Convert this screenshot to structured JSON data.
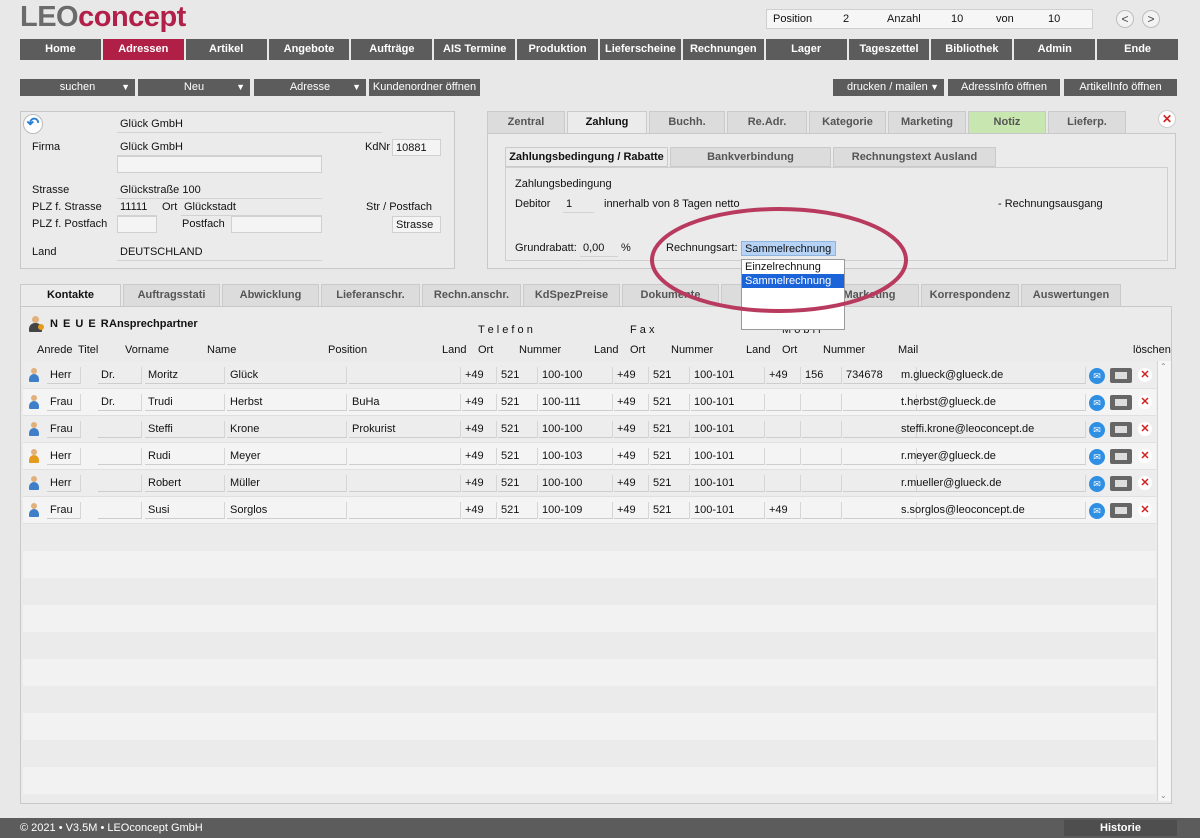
{
  "logo": {
    "part1": "LEO",
    "part2": "concept"
  },
  "pager": {
    "position_label": "Position",
    "position_value": "2",
    "count_label": "Anzahl",
    "count_value": "10",
    "of_label": "von",
    "of_value": "10",
    "prev": "<",
    "next": ">"
  },
  "nav": [
    "Home",
    "Adressen",
    "Artikel",
    "Angebote",
    "Aufträge",
    "AIS Termine",
    "Produktion",
    "Lieferscheine",
    "Rechnungen",
    "Lager",
    "Tageszettel",
    "Bibliothek",
    "Admin",
    "Ende"
  ],
  "toolbar": {
    "search": "suchen",
    "new": "Neu",
    "address": "Adresse",
    "customer_folder": "Kundenordner öffnen",
    "print": "drucken / mailen",
    "address_info": "AdressInfo öffnen",
    "article_info": "ArtikelInfo öffnen"
  },
  "address": {
    "name_line": "Glück GmbH",
    "firma_label": "Firma",
    "firma_value": "Glück GmbH",
    "kdnr_label": "KdNr",
    "kdnr_value": "10881",
    "strasse_label": "Strasse",
    "strasse_value": "Glückstraße 100",
    "plz_strasse_label": "PLZ f. Strasse",
    "plz_value": "11111",
    "ort_label": "Ort",
    "ort_value": "Glückstadt",
    "str_postfach_label": "Str / Postfach",
    "str_postfach_value": "Strasse",
    "plz_postfach_label": "PLZ f. Postfach",
    "postfach_label": "Postfach",
    "land_label": "Land",
    "land_value": "DEUTSCHLAND"
  },
  "right_tabs": [
    "Zentral",
    "Zahlung",
    "Buchh.",
    "Re.Adr.",
    "Kategorie",
    "Marketing",
    "Notiz",
    "Lieferp."
  ],
  "payment": {
    "subtabs": [
      "Zahlungsbedingung / Rabatte",
      "Bankverbindung",
      "Rechnungstext Ausland"
    ],
    "section_label": "Zahlungsbedingung",
    "debitor_label": "Debitor",
    "debitor_value": "1",
    "debitor_text": "innerhalb von 8 Tagen netto",
    "rechnungsausgang": "- Rechnungsausgang",
    "grundrabatt_label": "Grundrabatt:",
    "grundrabatt_value": "0,00",
    "percent": "%",
    "rechnungsart_label": "Rechnungsart:",
    "rechnungsart_value": "Sammelrechnung",
    "options": [
      "Einzelrechnung",
      "Sammelrechnung"
    ]
  },
  "bottom_tabs": [
    "Kontakte",
    "Auftragsstati",
    "Abwicklung",
    "Lieferanschr.",
    "Rechn.anschr.",
    "KdSpezPreise",
    "Dokumente",
    "Marketing",
    "Korrespondenz",
    "Auswertungen"
  ],
  "contacts": {
    "new_label": "N E U E R",
    "new_label2": "Ansprechpartner",
    "group_telefon": "T e l e f o n",
    "group_fax": "F a x",
    "group_mobil": "M o b i l",
    "headers": {
      "anrede": "Anrede",
      "titel": "Titel",
      "vorname": "Vorname",
      "name": "Name",
      "position": "Position",
      "land": "Land",
      "ort": "Ort",
      "nummer": "Nummer",
      "mail": "Mail",
      "loeschen": "löschen"
    },
    "rows": [
      {
        "anrede": "Herr",
        "titel": "Dr.",
        "vorname": "Moritz",
        "name": "Glück",
        "position": "",
        "t_land": "+49",
        "t_ort": "521",
        "t_nr": "100-100",
        "f_land": "+49",
        "f_ort": "521",
        "f_nr": "100-101",
        "m_land": "+49",
        "m_ort": "156",
        "m_nr": "734678",
        "mail": "m.glueck@glueck.de",
        "icon": "person-icon"
      },
      {
        "anrede": "Frau",
        "titel": "Dr.",
        "vorname": "Trudi",
        "name": "Herbst",
        "position": "BuHa",
        "t_land": "+49",
        "t_ort": "521",
        "t_nr": "100-111",
        "f_land": "+49",
        "f_ort": "521",
        "f_nr": "100-101",
        "m_land": "",
        "m_ort": "",
        "m_nr": "",
        "mail": "t.herbst@glueck.de",
        "icon": "person-icon"
      },
      {
        "anrede": "Frau",
        "titel": "",
        "vorname": "Steffi",
        "name": "Krone",
        "position": "Prokurist",
        "t_land": "+49",
        "t_ort": "521",
        "t_nr": "100-100",
        "f_land": "+49",
        "f_ort": "521",
        "f_nr": "100-101",
        "m_land": "",
        "m_ort": "",
        "m_nr": "",
        "mail": "steffi.krone@leoconcept.de",
        "icon": "person-icon"
      },
      {
        "anrede": "Herr",
        "titel": "",
        "vorname": "Rudi",
        "name": "Meyer",
        "position": "",
        "t_land": "+49",
        "t_ort": "521",
        "t_nr": "100-103",
        "f_land": "+49",
        "f_ort": "521",
        "f_nr": "100-101",
        "m_land": "",
        "m_ort": "",
        "m_nr": "",
        "mail": "r.meyer@glueck.de",
        "icon": "person-icon-orange"
      },
      {
        "anrede": "Herr",
        "titel": "",
        "vorname": "Robert",
        "name": "Müller",
        "position": "",
        "t_land": "+49",
        "t_ort": "521",
        "t_nr": "100-100",
        "f_land": "+49",
        "f_ort": "521",
        "f_nr": "100-101",
        "m_land": "",
        "m_ort": "",
        "m_nr": "",
        "mail": "r.mueller@glueck.de",
        "icon": "person-icon"
      },
      {
        "anrede": "Frau",
        "titel": "",
        "vorname": "Susi",
        "name": "Sorglos",
        "position": "",
        "t_land": "+49",
        "t_ort": "521",
        "t_nr": "100-109",
        "f_land": "+49",
        "f_ort": "521",
        "f_nr": "100-101",
        "m_land": "+49",
        "m_ort": "",
        "m_nr": "",
        "mail": "s.sorglos@leoconcept.de",
        "icon": "person-icon"
      }
    ]
  },
  "footer": {
    "copyright": "© 2021 • V3.5M • LEOconcept GmbH",
    "history": "Historie"
  },
  "colors": {
    "accent": "#b01f46",
    "nav_bg": "#5c5c5c",
    "highlight_circle": "#b83a5e",
    "selection": "#1a63d8"
  }
}
